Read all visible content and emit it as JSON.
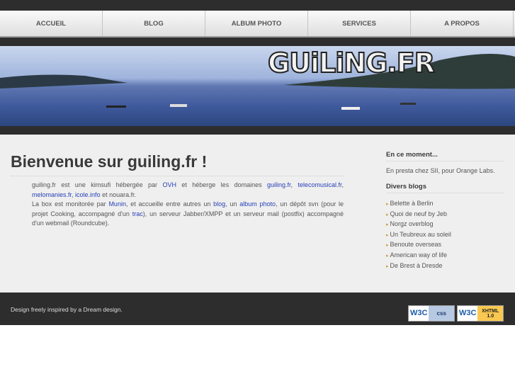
{
  "nav": [
    "ACCUEIL",
    "BLOG",
    "ALBUM PHOTO",
    "SERVICES",
    "A PROPOS"
  ],
  "logo": "GUiLiNG.FR",
  "main": {
    "title": "Bienvenue sur guiling.fr !",
    "p1_a": "guiling.fr est une kimsufi hébergée par ",
    "ovh": "OVH",
    "p1_b": " et héberge les domaines ",
    "d1": "guiling.fr",
    ",": ", ",
    "d2": "telecomusical.fr",
    "d3": "melomanies.fr",
    "d4": "icole.info",
    "p1_c": " et nouara.fr.",
    "p2_a": "La box est monitorée par ",
    "munin": "Munin",
    "p2_b": ", et accueille entre autres un ",
    "blog": "blog",
    "p2_c": ", un ",
    "album": "album photo",
    "p2_d": ", un dépôt svn (pour le projet Cooking, accompagné d'un ",
    "trac": "trac",
    "p2_e": "), un serveur Jabber/XMPP et un serveur mail (postfix) accompagné d'un webmail (Roundcube)."
  },
  "sidebar": {
    "moment_title": "En ce moment...",
    "moment_text": "En presta chez SII, pour Orange Labs.",
    "blogs_title": "Divers blogs",
    "blogs": [
      "Belette à Berlin",
      "Quoi de neuf by Jeb",
      "Norgz overblog",
      "Un Teubreux au soleil",
      "Benoute overseas",
      "American way of life",
      "De Brest à Dresde"
    ]
  },
  "footer": {
    "text": "Design freely inspired by a Dream design.",
    "w3c": "W3C",
    "css": "css",
    "xhtml": "XHTML 1.0"
  }
}
